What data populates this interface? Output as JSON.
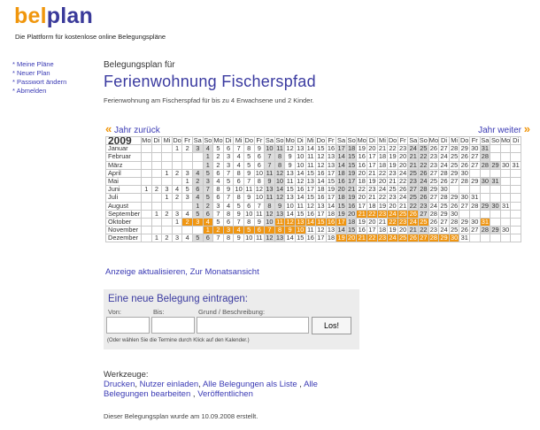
{
  "logo": {
    "part1": "bel",
    "part2": "plan",
    "tagline": "Die Plattform für kostenlose online Belegungspläne"
  },
  "nav": [
    "Meine Pläne",
    "Neuer Plan",
    "Passwort ändern",
    "Abmelden"
  ],
  "plan": {
    "subtitle": "Belegungsplan für",
    "title": "Ferienwohnung Fischerspfad",
    "description": "Ferienwohnung am Fischerspfad für bis zu 4 Erwachsene und 2 Kinder."
  },
  "year_nav": {
    "prev": "Jahr zurück",
    "next": "Jahr weiter",
    "prev_arrow": "«",
    "next_arrow": "»"
  },
  "calendar": {
    "year": "2009",
    "weekdays": [
      "Mo",
      "Di",
      "Mi",
      "Do",
      "Fr",
      "Sa",
      "So"
    ],
    "months": [
      {
        "name": "Januar",
        "start": 3,
        "days": 31,
        "booked": []
      },
      {
        "name": "Februar",
        "start": 6,
        "days": 28,
        "booked": []
      },
      {
        "name": "März",
        "start": 6,
        "days": 31,
        "booked": []
      },
      {
        "name": "April",
        "start": 2,
        "days": 30,
        "booked": []
      },
      {
        "name": "Mai",
        "start": 4,
        "days": 31,
        "booked": []
      },
      {
        "name": "Juni",
        "start": 0,
        "days": 30,
        "booked": []
      },
      {
        "name": "Juli",
        "start": 2,
        "days": 31,
        "booked": []
      },
      {
        "name": "August",
        "start": 5,
        "days": 31,
        "booked": []
      },
      {
        "name": "September",
        "start": 1,
        "days": 30,
        "booked": [
          21,
          22,
          23,
          24,
          25,
          26
        ]
      },
      {
        "name": "Oktober",
        "start": 3,
        "days": 31,
        "booked": [
          2,
          3,
          4,
          11,
          12,
          13,
          14,
          15,
          16,
          17,
          22,
          23,
          24,
          25,
          31
        ]
      },
      {
        "name": "November",
        "start": 6,
        "days": 30,
        "booked": [
          1,
          2,
          3,
          4,
          5,
          6,
          7,
          8,
          9,
          10
        ]
      },
      {
        "name": "Dezember",
        "start": 1,
        "days": 31,
        "booked": [
          19,
          20,
          21,
          22,
          23,
          24,
          25,
          26,
          27,
          28,
          29,
          30
        ]
      }
    ]
  },
  "after_calendar": "Anzeige aktualisieren, Zur Monatsansicht",
  "form": {
    "title": "Eine neue Belegung eintragen:",
    "from_label": "Von:",
    "to_label": "Bis:",
    "reason_label": "Grund / Beschreibung:",
    "from_value": "",
    "to_value": "",
    "reason_value": "",
    "submit": "Los!",
    "hint": "(Oder wählen Sie die Termine durch Klick auf den Kalender.)"
  },
  "tools": {
    "heading": "Werkzeuge:",
    "links": [
      "Drucken",
      "Nutzer einladen",
      "Alle Belegungen als Liste",
      "Alle Belegungen bearbeiten",
      "Veröffentlichen"
    ]
  },
  "footer": "Dieser Belegungsplan wurde am 10.09.2008 erstellt.",
  "colors": {
    "brand_orange": "#f0960c",
    "brand_blue": "#3a3a9a",
    "booked": "#f09612",
    "weekend": "#dcdcdc"
  }
}
